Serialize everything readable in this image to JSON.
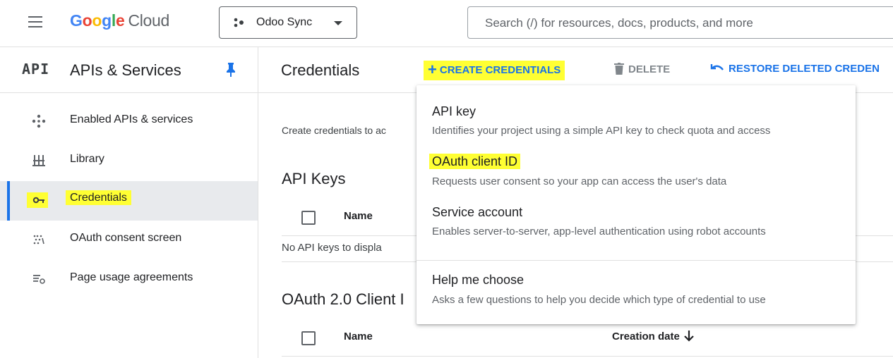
{
  "topbar": {
    "logo_letters": [
      "G",
      "o",
      "o",
      "g",
      "l",
      "e"
    ],
    "logo_suffix": "Cloud",
    "project_name": "Odoo Sync",
    "search_placeholder": "Search (/) for resources, docs, products, and more"
  },
  "sidenav": {
    "badge": "API",
    "title": "APIs & Services",
    "items": [
      {
        "label": "Enabled APIs & services",
        "icon": "enabled-apis-icon"
      },
      {
        "label": "Library",
        "icon": "library-icon"
      },
      {
        "label": "Credentials",
        "icon": "key-icon",
        "active": true
      },
      {
        "label": "OAuth consent screen",
        "icon": "consent-icon"
      },
      {
        "label": "Page usage agreements",
        "icon": "agreements-icon"
      }
    ]
  },
  "main": {
    "title": "Credentials",
    "toolbar": {
      "create_label": "CREATE CREDENTIALS",
      "delete_label": "DELETE",
      "restore_label": "RESTORE DELETED CREDEN"
    },
    "intro_text": "Create credentials to ac",
    "api_keys": {
      "heading": "API Keys",
      "col_name": "Name",
      "empty_text": "No API keys to displa"
    },
    "oauth": {
      "heading": "OAuth 2.0 Client I",
      "col_name": "Name",
      "col_date": "Creation date"
    }
  },
  "dropdown": {
    "items": [
      {
        "title": "API key",
        "desc": "Identifies your project using a simple API key to check quota and access"
      },
      {
        "title": "OAuth client ID",
        "desc": "Requests user consent so your app can access the user's data"
      },
      {
        "title": "Service account",
        "desc": "Enables server-to-server, app-level authentication using robot accounts"
      },
      {
        "title": "Help me choose",
        "desc": "Asks a few questions to help you decide which type of credential to use"
      }
    ]
  },
  "colors": {
    "accent": "#1a73e8",
    "highlight": "#ffff33",
    "active_nav_bg": "#e8eaed"
  }
}
